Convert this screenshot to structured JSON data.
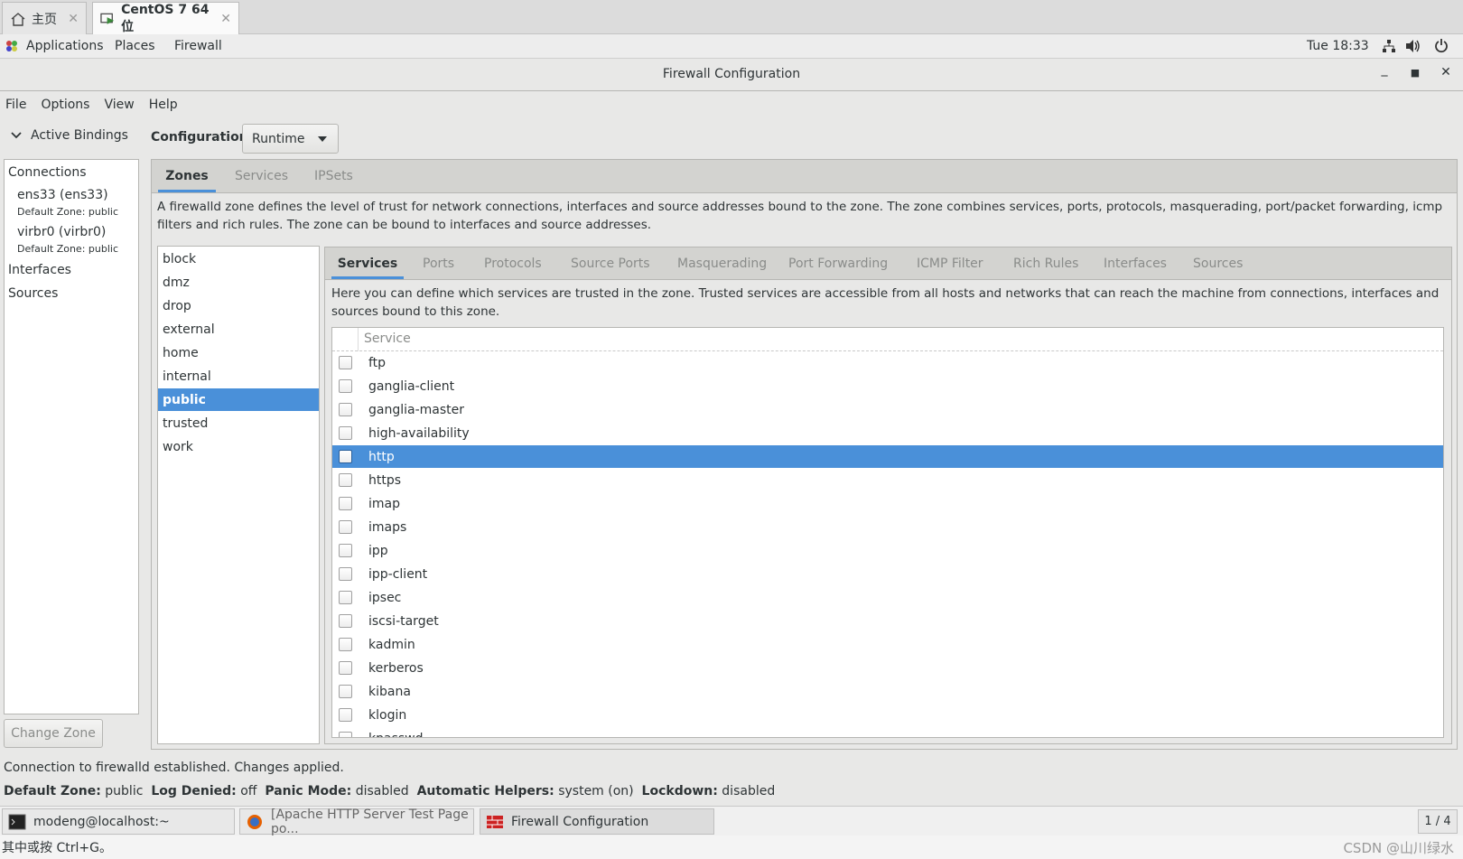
{
  "vm_tabs": [
    {
      "label": "主页",
      "icon": "home-icon"
    },
    {
      "label": "CentOS 7 64 位",
      "icon": "vm-icon"
    }
  ],
  "topbar": {
    "menus": [
      "Applications",
      "Places",
      "Firewall"
    ],
    "clock": "Tue 18:33"
  },
  "window": {
    "title": "Firewall Configuration"
  },
  "menubar": [
    "File",
    "Options",
    "View",
    "Help"
  ],
  "left": {
    "header": "Active Bindings",
    "connections_label": "Connections",
    "connections": [
      {
        "name": "ens33 (ens33)",
        "zone": "Default Zone: public"
      },
      {
        "name": "virbr0 (virbr0)",
        "zone": "Default Zone: public"
      }
    ],
    "interfaces_label": "Interfaces",
    "sources_label": "Sources",
    "change_zone": "Change Zone"
  },
  "config": {
    "label": "Configuration:",
    "value": "Runtime"
  },
  "main_tabs": [
    "Zones",
    "Services",
    "IPSets"
  ],
  "zones_desc": "A firewalld zone defines the level of trust for network connections, interfaces and source addresses bound to the zone. The zone combines services, ports, protocols, masquerading, port/packet forwarding, icmp filters and rich rules. The zone can be bound to interfaces and source addresses.",
  "zones": [
    "block",
    "dmz",
    "drop",
    "external",
    "home",
    "internal",
    "public",
    "trusted",
    "work"
  ],
  "selected_zone": "public",
  "zone_tabs": [
    "Services",
    "Ports",
    "Protocols",
    "Source Ports",
    "Masquerading",
    "Port Forwarding",
    "ICMP Filter",
    "Rich Rules",
    "Interfaces",
    "Sources"
  ],
  "services_desc": "Here you can define which services are trusted in the zone. Trusted services are accessible from all hosts and networks that can reach the machine from connections, interfaces and sources bound to this zone.",
  "services_col": "Service",
  "services": [
    "ftp",
    "ganglia-client",
    "ganglia-master",
    "high-availability",
    "http",
    "https",
    "imap",
    "imaps",
    "ipp",
    "ipp-client",
    "ipsec",
    "iscsi-target",
    "kadmin",
    "kerberos",
    "kibana",
    "klogin",
    "kpasswd"
  ],
  "selected_service": "http",
  "status": {
    "line1": "Connection to firewalld established.  Changes applied.",
    "default_zone_label": "Default Zone:",
    "default_zone": "public",
    "log_denied_label": "Log Denied:",
    "log_denied": "off",
    "panic_label": "Panic Mode:",
    "panic": "disabled",
    "helpers_label": "Automatic Helpers:",
    "helpers": "system (on)",
    "lockdown_label": "Lockdown:",
    "lockdown": "disabled"
  },
  "taskbar": {
    "items": [
      "modeng@localhost:~",
      "[Apache HTTP Server Test Page po...",
      "Firewall Configuration"
    ],
    "pager": "1 / 4"
  },
  "ime_hint": "其中或按 Ctrl+G。",
  "watermark": "CSDN @山川绿水",
  "colors": {
    "accent": "#4a90d9"
  }
}
